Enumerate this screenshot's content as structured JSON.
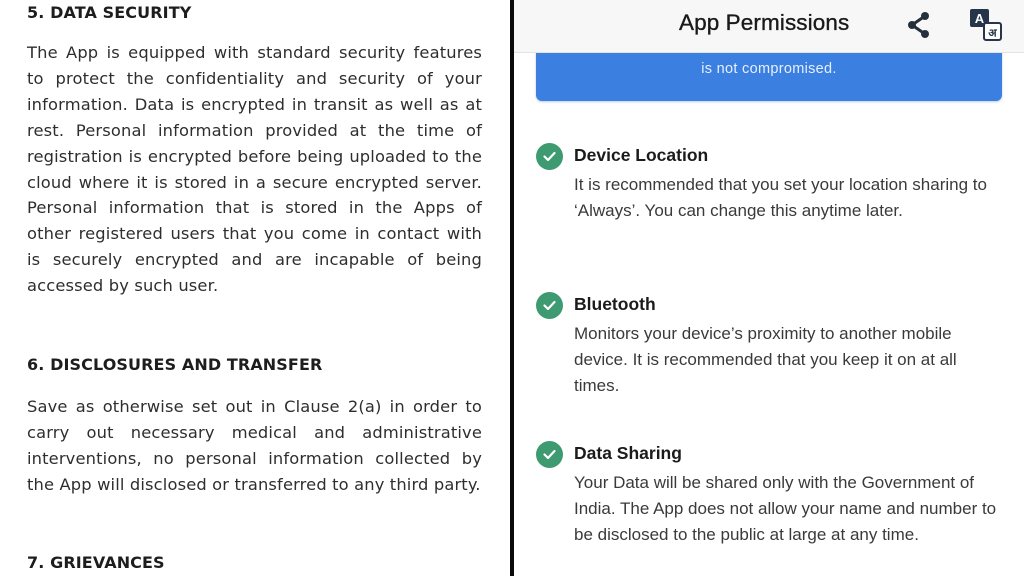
{
  "document": {
    "sections": [
      {
        "heading": "5. DATA SECURITY",
        "body": "The App is equipped with standard security features to protect the confidentiality and security of your information. Data is encrypted in transit as well as at rest. Personal information provided at the time of registration is encrypted before being uploaded to the cloud where it is stored in a secure encrypted server. Personal information that is stored in the Apps of other registered users that you come in contact with is securely encrypted and are incapable of being accessed by such user."
      },
      {
        "heading": "6. DISCLOSURES AND TRANSFER",
        "body": "Save as otherwise set out in Clause 2(a) in order to carry out necessary medical and administrative interventions, no personal information collected by the App will disclosed or transferred to any third party."
      },
      {
        "heading": "7. GRIEVANCES",
        "body": ""
      }
    ]
  },
  "app": {
    "header": {
      "title": "App Permissions",
      "share_icon": "share-icon",
      "translate_icon": "translate-icon",
      "translate_glyph_top": "A",
      "translate_glyph_bottom": "अ"
    },
    "banner": {
      "text": "is not compromised.",
      "color": "#3b7fe0"
    },
    "permissions": [
      {
        "title": "Device Location",
        "description": "It is recommended that you set your location sharing to ‘Always’. You can change this anytime later.",
        "status": "granted"
      },
      {
        "title": "Bluetooth",
        "description": "Monitors your device’s proximity to another mobile device. It is recommended that you keep it on at all times.",
        "status": "granted"
      },
      {
        "title": "Data Sharing",
        "description": "Your Data will be shared only with the Government of India. The App does not allow your name and number to be disclosed to the public at large at any time.",
        "status": "granted"
      }
    ],
    "check_color": "#3e9a70"
  }
}
